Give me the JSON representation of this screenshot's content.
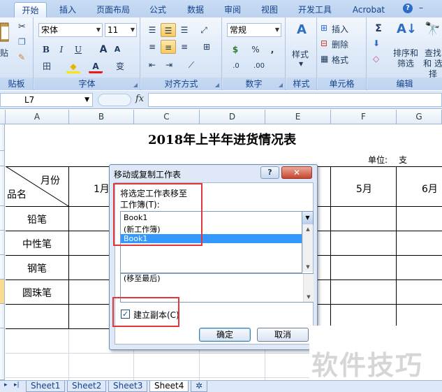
{
  "ribbon": {
    "tabs": [
      "开始",
      "插入",
      "页面布局",
      "公式",
      "数据",
      "审阅",
      "视图",
      "开发工具",
      "Acrobat"
    ],
    "active_tab": "开始",
    "clipboard": {
      "paste": "贴",
      "label": "贴板"
    },
    "font": {
      "name": "宋体",
      "size": "11",
      "bold": "B",
      "italic": "I",
      "underline": "U",
      "grow": "A",
      "shrink": "A",
      "border": "田",
      "fill": "◆",
      "color": "A",
      "phonetic": "变",
      "label": "字体"
    },
    "alignment": {
      "label": "对齐方式"
    },
    "number": {
      "format": "常规",
      "currency": "$",
      "percent": "%",
      "comma": ",",
      "inc": ".0",
      "dec": ".00",
      "label": "数字"
    },
    "styles": {
      "label": "样式",
      "group_label": "样式"
    },
    "cells": {
      "insert": "插入",
      "delete": "删除",
      "format": "格式",
      "label": "单元格"
    },
    "editing": {
      "sum": "Σ",
      "sort_filter": "排序和 筛选",
      "find_select": "查找和 选择",
      "label": "编辑"
    },
    "right_icons": {
      "help": "?",
      "min": "–"
    }
  },
  "formula_bar": {
    "cell_ref": "L7",
    "fx": "fx",
    "formula": ""
  },
  "columns": [
    "A",
    "B",
    "C",
    "D",
    "E",
    "F",
    "G"
  ],
  "sheet": {
    "title": "2018年上半年进货情况表",
    "unit_label": "单位:",
    "unit_value": "支",
    "header_diag_top": "月份",
    "header_diag_bottom": "品名",
    "months": [
      "1月",
      "5月",
      "6月"
    ],
    "items": [
      "铅笔",
      "中性笔",
      "钢笔",
      "圆珠笔"
    ]
  },
  "sheet_tabs": {
    "tabs": [
      "Sheet1",
      "Sheet2",
      "Sheet3",
      "Sheet4"
    ],
    "active": "Sheet4"
  },
  "dialog": {
    "title": "移动或复制工作表",
    "help": "?",
    "close": "✕",
    "move_label": "将选定工作表移至",
    "workbook_label": "工作簿(T):",
    "workbook_value": "Book1",
    "workbook_options": [
      "(新工作簿)",
      "Book1"
    ],
    "selected_option": "Book1",
    "before_sheet_item": "(移至最后)",
    "create_copy_label": "建立副本(C)",
    "create_copy_checked": true,
    "ok": "确定",
    "cancel": "取消"
  },
  "watermark": "软件技巧"
}
